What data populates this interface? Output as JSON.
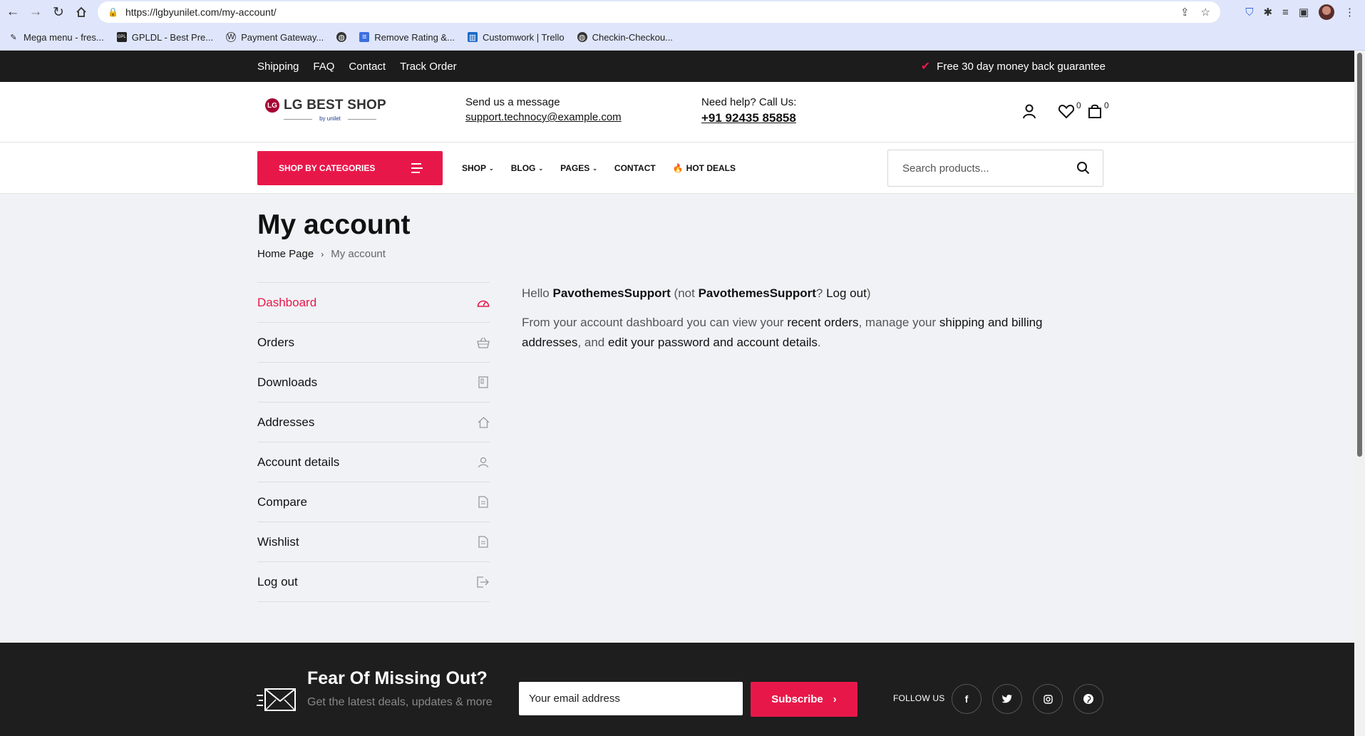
{
  "browser": {
    "url": "https://lgbyunilet.com/my-account/",
    "bookmarks": [
      {
        "label": "Mega menu - fres..."
      },
      {
        "label": "GPLDL - Best Pre..."
      },
      {
        "label": "Payment Gateway..."
      },
      {
        "label": ""
      },
      {
        "label": "Remove Rating &..."
      },
      {
        "label": "Customwork | Trello"
      },
      {
        "label": "Checkin-Checkou..."
      }
    ]
  },
  "topbar": {
    "links": [
      "Shipping",
      "FAQ",
      "Contact",
      "Track Order"
    ],
    "guarantee": "Free 30 day money back guarantee"
  },
  "header": {
    "logo_text": "LG BEST SHOP",
    "logo_sub": "by unilet",
    "logo_mark": "LG",
    "message_label": "Send us a message",
    "message_email": "support.technocy@example.com",
    "help_label": "Need help? Call Us:",
    "help_phone": "+91 92435 85858",
    "wishlist_count": "0",
    "cart_count": "0"
  },
  "nav": {
    "categories_label": "SHOP BY CATEGORIES",
    "items": [
      "SHOP",
      "BLOG",
      "PAGES",
      "CONTACT",
      "HOT DEALS"
    ],
    "search_placeholder": "Search products..."
  },
  "page": {
    "title": "My account",
    "breadcrumb_home": "Home Page",
    "breadcrumb_separator": "›",
    "breadcrumb_current": "My account"
  },
  "account_nav": [
    {
      "label": "Dashboard",
      "icon": "dashboard-icon"
    },
    {
      "label": "Orders",
      "icon": "basket-icon"
    },
    {
      "label": "Downloads",
      "icon": "file-icon"
    },
    {
      "label": "Addresses",
      "icon": "home-icon"
    },
    {
      "label": "Account details",
      "icon": "user-icon"
    },
    {
      "label": "Compare",
      "icon": "document-icon"
    },
    {
      "label": "Wishlist",
      "icon": "document-icon"
    },
    {
      "label": "Log out",
      "icon": "logout-icon"
    }
  ],
  "dashboard": {
    "hello": "Hello",
    "username": "PavothemesSupport",
    "not_open": "(not",
    "username2": "PavothemesSupport",
    "qmark": "?",
    "logout": "Log out",
    "close_paren": ")",
    "desc_1": "From your account dashboard you can view your",
    "recent_orders": "recent orders",
    "desc_2": ", manage your",
    "shipping_billing": "shipping and billing addresses",
    "desc_3": ", and",
    "edit_account": "edit your password and account details",
    "desc_4": "."
  },
  "footer": {
    "title": "Fear Of Missing Out?",
    "subtitle": "Get the latest deals, updates & more",
    "email_placeholder": "Your email address",
    "subscribe_label": "Subscribe",
    "follow_label": "FOLLOW US",
    "socials": [
      "f",
      "twitter",
      "instagram",
      "pinterest"
    ]
  },
  "colors": {
    "accent": "#e8174a",
    "dark": "#1c1c1c",
    "page_bg": "#f1f2f6"
  }
}
